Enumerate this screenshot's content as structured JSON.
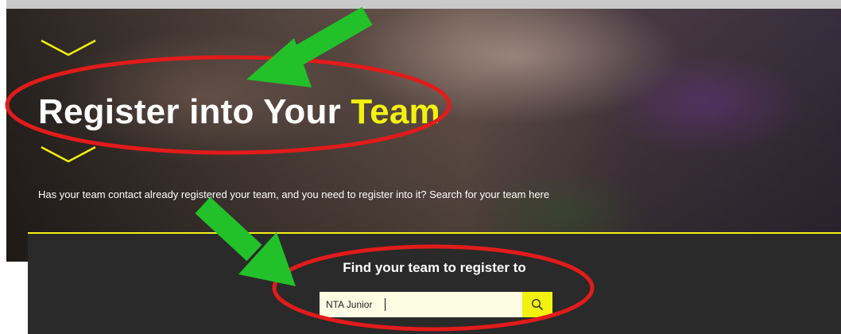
{
  "hero": {
    "title_main": "Register into Your ",
    "title_accent": "Team",
    "subtitle": "Has your team contact already registered your team, and you need to register into it? Search for your team here"
  },
  "search_panel": {
    "title": "Find your team to register to",
    "input_value": "NTA Junior",
    "button_icon": "search-icon"
  },
  "colors": {
    "accent_yellow": "#f2f20f",
    "panel_dark": "#2a2a2a",
    "annotation_red": "#e21b1b",
    "annotation_green": "#22c12a"
  }
}
